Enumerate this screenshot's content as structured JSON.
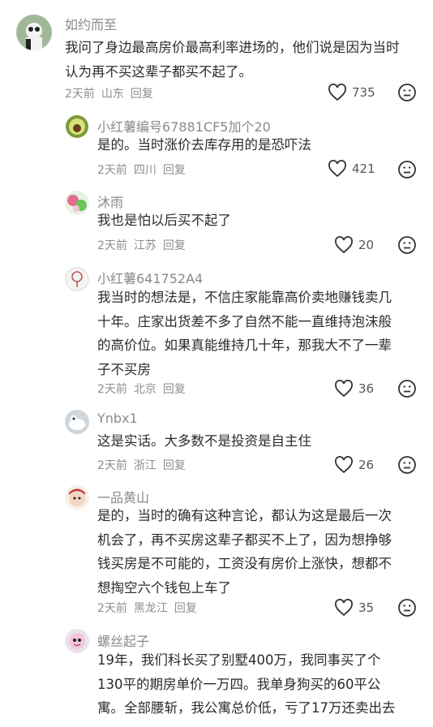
{
  "comments": [
    {
      "name": "如约而至",
      "lines": [
        "我问了身边最高房价最高利率进场的，他们说是因为当时",
        "认为再不买这辈子都买不起了。"
      ],
      "time": "2天前",
      "location": "山东",
      "reply": "回复",
      "likes": "735"
    },
    {
      "name": "小红薯编号67881CF5加个20",
      "lines": [
        "是的。当时涨价去库存用的是恐吓法"
      ],
      "time": "2天前",
      "location": "四川",
      "reply": "回复",
      "likes": "421"
    },
    {
      "name": "沐雨",
      "lines": [
        "我也是怕以后买不起了"
      ],
      "time": "2天前",
      "location": "江苏",
      "reply": "回复",
      "likes": "20"
    },
    {
      "name": "小红薯641752A4",
      "lines": [
        "我当时的想法是，不信庄家能靠高价卖地赚钱卖几",
        "十年。庄家出货差不多了自然不能一直维持泡沫般",
        "的高价位。如果真能维持几十年，那我大不了一辈",
        "子不买房"
      ],
      "time": "2天前",
      "location": "北京",
      "reply": "回复",
      "likes": "36"
    },
    {
      "name": "Ynbx1",
      "lines": [
        "这是实话。大多数不是投资是自主住"
      ],
      "time": "2天前",
      "location": "浙江",
      "reply": "回复",
      "likes": "26"
    },
    {
      "name": "一品黄山",
      "lines": [
        "是的，当时的确有这种言论，都认为这是最后一次",
        "机会了，再不买房这辈子都买不上了，因为想挣够",
        "钱买房是不可能的，工资没有房价上涨快，想都不",
        "想掏空六个钱包上车了"
      ],
      "time": "2天前",
      "location": "黑龙江",
      "reply": "回复",
      "likes": "35"
    },
    {
      "name": "螺丝起子",
      "lines": [
        "19年，我们科长买了别墅400万，我同事买了个",
        "130平的期房单价一万四。我单身狗买的60平公",
        "寓。全部腰斩，我公寓总价低，亏了17万还卖出去"
      ],
      "time": "",
      "location": "",
      "reply": "",
      "likes": ""
    }
  ]
}
